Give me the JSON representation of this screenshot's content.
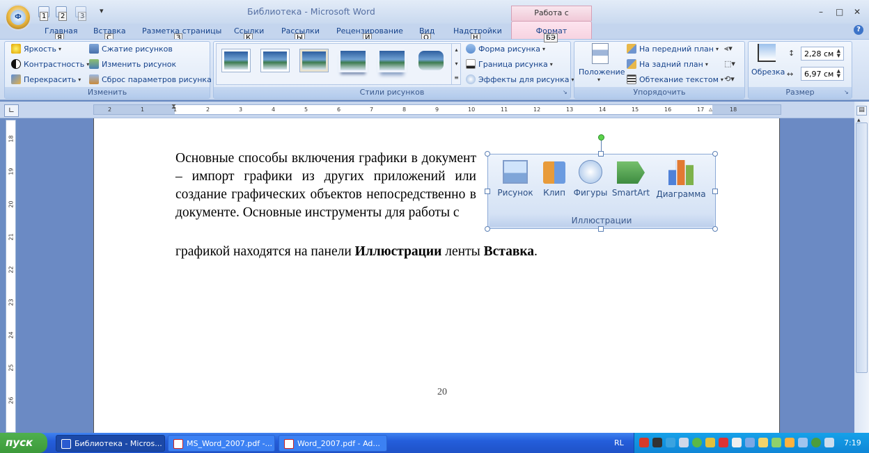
{
  "window": {
    "title": "Библиотека - Microsoft Word",
    "contextual_tab": "Работа с рисунками",
    "minimize": "–",
    "maximize": "□",
    "close": "✕",
    "help": "?"
  },
  "office_button": {
    "keytip": "Ф"
  },
  "quick_access": {
    "keytips": [
      "1",
      "2",
      "3"
    ],
    "customize": "▾"
  },
  "tabs": [
    {
      "label": "Главная",
      "keytip": "Я"
    },
    {
      "label": "Вставка",
      "keytip": "С"
    },
    {
      "label": "Разметка страницы",
      "keytip": "З"
    },
    {
      "label": "Ссылки",
      "keytip": "К"
    },
    {
      "label": "Рассылки",
      "keytip": "Ы"
    },
    {
      "label": "Рецензирование",
      "keytip": "И"
    },
    {
      "label": "Вид",
      "keytip": "О"
    },
    {
      "label": "Надстройки",
      "keytip": "Н"
    },
    {
      "label": "Формат",
      "keytip": "БЭ"
    }
  ],
  "ribbon": {
    "adjust": {
      "caption": "Изменить",
      "brightness": "Яркость",
      "contrast": "Контрастность",
      "recolor": "Перекрасить",
      "compress": "Сжатие рисунков",
      "change": "Изменить рисунок",
      "reset": "Сброс параметров рисунка"
    },
    "styles": {
      "caption": "Стили рисунков",
      "shape": "Форма рисунка",
      "border": "Граница рисунка",
      "effects": "Эффекты для рисунка"
    },
    "arrange": {
      "caption": "Упорядочить",
      "position": "Положение",
      "front": "На передний план",
      "back": "На задний план",
      "wrap": "Обтекание текстом"
    },
    "size": {
      "caption": "Размер",
      "crop": "Обрезка",
      "height": "2,28 см",
      "width": "6,97 см"
    }
  },
  "ruler": {
    "h_numbers": [
      "2",
      "1",
      "1",
      "2",
      "3",
      "4",
      "5",
      "6",
      "7",
      "8",
      "9",
      "10",
      "11",
      "12",
      "13",
      "14",
      "15",
      "16",
      "17",
      "18"
    ],
    "v_numbers": [
      "18",
      "19",
      "20",
      "21",
      "22",
      "23",
      "24",
      "25",
      "26"
    ]
  },
  "document": {
    "paragraph_main": "Основные способы включения графики в документ – импорт графики из других приложений или создание графических объектов непосредственно в документе. Основные инструменты для работы с",
    "last_line_start": "графикой находятся на панели ",
    "bold_1": "Иллюстрации",
    "middle": " ленты ",
    "bold_2": "Вставка",
    "end": ".",
    "page_number": "20"
  },
  "illustration": {
    "items": [
      "Рисунок",
      "Клип",
      "Фигуры",
      "SmartArt",
      "Диаграмма"
    ],
    "caption": "Иллюстрации"
  },
  "taskbar": {
    "start": "пуск",
    "tasks": [
      "Библиотека - Micros...",
      "MS_Word_2007.pdf -...",
      "Word_2007.pdf - Ad..."
    ],
    "lang": "RL",
    "clock": "7:19"
  }
}
